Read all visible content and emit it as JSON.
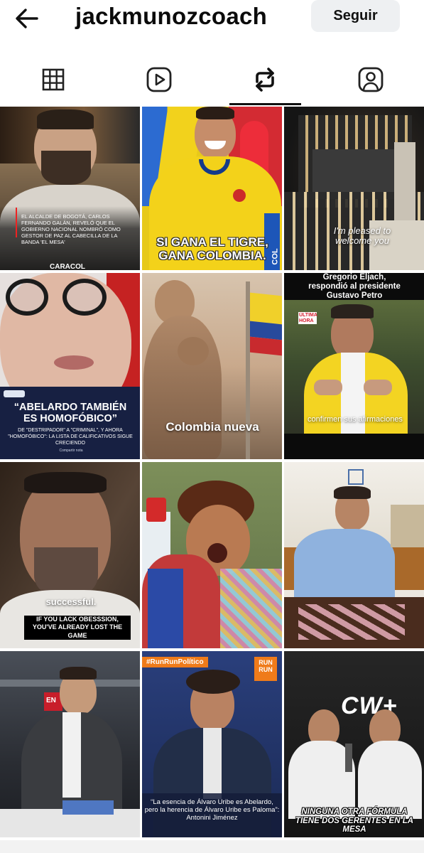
{
  "header": {
    "back_icon": "arrow-left-icon",
    "username": "jackmunozcoach",
    "follow_label": "Seguir"
  },
  "tabs": [
    {
      "name": "grid",
      "icon": "grid-icon",
      "active": false
    },
    {
      "name": "reels",
      "icon": "reels-icon",
      "active": false
    },
    {
      "name": "reposts",
      "icon": "repost-icon",
      "active": true
    },
    {
      "name": "tagged",
      "icon": "tagged-person-icon",
      "active": false
    }
  ],
  "posts": [
    {
      "caption": "EL ALCALDE DE BOGOTÁ, CARLOS FERNANDO GALÁN, REVELÓ QUE EL GOBIERNO NACIONAL NOMBRÓ COMO GESTOR DE PAZ AL CABECILLA DE LA BANDA 'EL MESA'",
      "brand": "CARACOL"
    },
    {
      "caption": "SI GANA EL TIGRE, GANA COLOMBIA.",
      "side_text": "COL"
    },
    {
      "caption": "I'm pleased to welcome you"
    },
    {
      "caption": "“ABELARDO TAMBIÉN ES HOMOFÓBICO”",
      "subcaption": "DE \"DESTRIPADOR\" A \"CRIMINAL\", Y AHORA \"HOMOFÓBICO\": LA LISTA DE CALIFICATIVOS SIGUE CRECIENDO",
      "footer": "Compartir nota"
    },
    {
      "caption": "Colombia nueva"
    },
    {
      "headline": "Gregorio Eljach, respondió al presidente Gustavo Petro",
      "badge": "ÚLTIMA HORA",
      "caption": "confirmen sus afirmaciones"
    },
    {
      "caption": "successful.",
      "subcaption": "IF YOU LACK OBESSSION, YOU'VE ALREADY LOST THE GAME"
    },
    {
      "caption": ""
    },
    {
      "caption": ""
    },
    {
      "caption": "",
      "badge": "EN"
    },
    {
      "hashtag": "#RunRunPolítico",
      "logo": "RUN RUN",
      "caption": "“La esencia de Álvaro Uribe es Abelardo, pero la herencia de Álvaro Uribe es Paloma”: Antonini Jiménez"
    },
    {
      "logo": "CW+",
      "caption": "NINGUNA OTRA FÓRMULA TIENE DOS GERENTES EN LA MESA"
    }
  ],
  "colors": {
    "follow_bg": "#eef0f2",
    "text": "#111111"
  }
}
